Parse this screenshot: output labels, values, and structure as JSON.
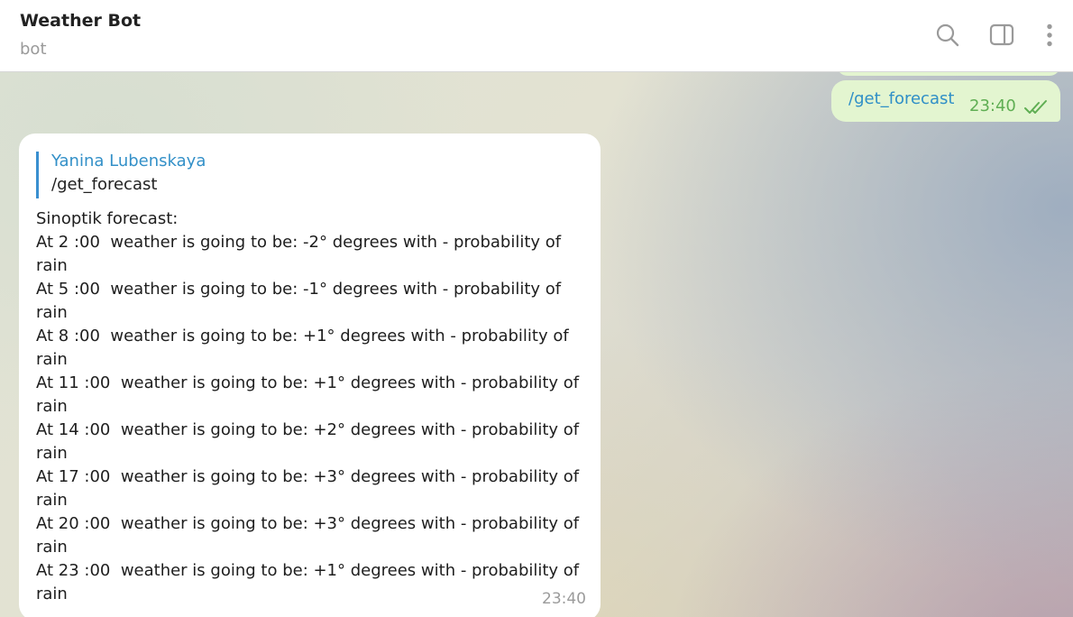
{
  "header": {
    "title": "Weather Bot",
    "status": "bot",
    "icons": [
      "search-icon",
      "sidebar-toggle-icon",
      "more-vertical-icon"
    ]
  },
  "messages": {
    "outgoing": {
      "text": "/get_forecast",
      "time": "23:40",
      "status_icon": "double-check-icon"
    },
    "incoming": {
      "reply_to": {
        "author": "Yanina Lubenskaya",
        "text": "/get_forecast"
      },
      "lines": [
        "Sinoptik forecast:",
        "At 2 :00  weather is going to be: -2° degrees with - probability of",
        "rain",
        "At 5 :00  weather is going to be: -1° degrees with - probability of",
        "rain",
        "At 8 :00  weather is going to be: +1° degrees with - probability of",
        "rain",
        "At 11 :00  weather is going to be: +1° degrees with - probability of",
        "rain",
        "At 14 :00  weather is going to be: +2° degrees with - probability of",
        "rain",
        "At 17 :00  weather is going to be: +3° degrees with - probability of",
        "rain",
        "At 20 :00  weather is going to be: +3° degrees with - probability of",
        "rain",
        "At 23 :00  weather is going to be: +1° degrees with - probability of",
        "rain"
      ],
      "time": "23:40"
    }
  },
  "colors": {
    "outgoing_bubble": "#e3f5d0",
    "link_blue": "#2f8fc7",
    "time_green": "#5fae53",
    "reply_accent": "#3a8fd0"
  }
}
